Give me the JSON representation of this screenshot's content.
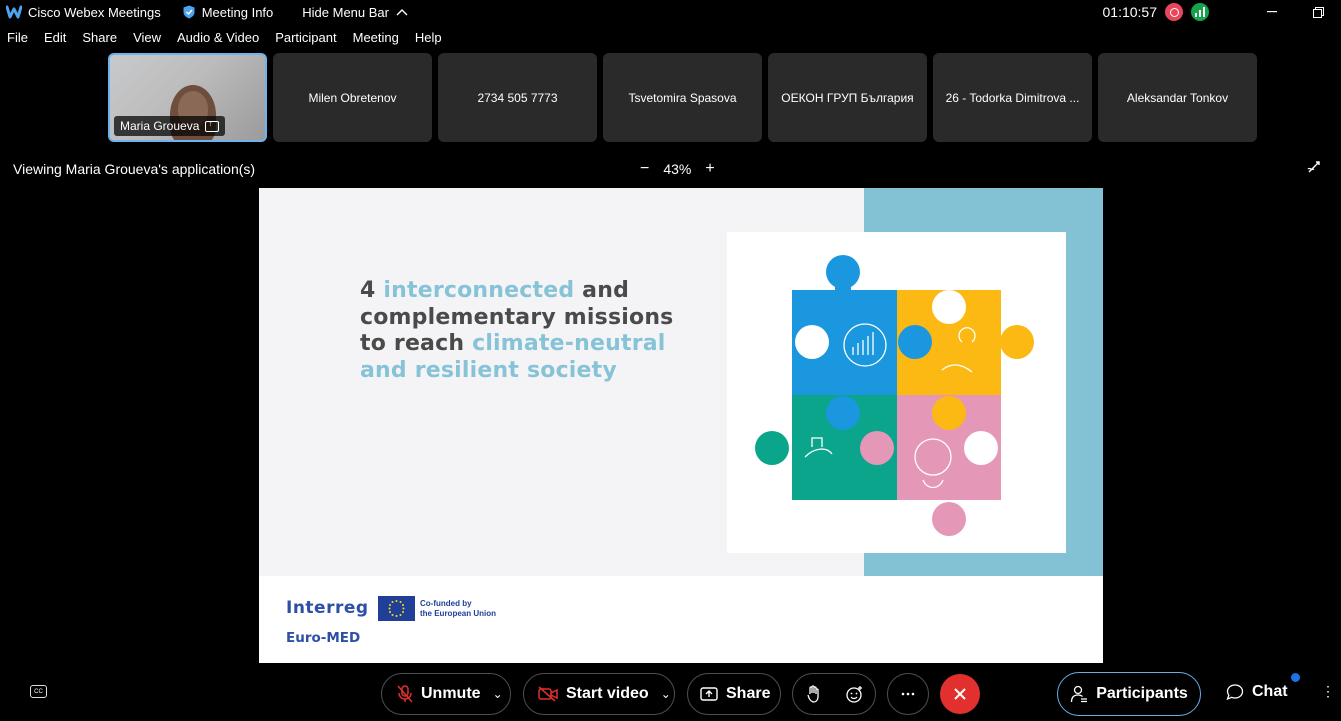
{
  "titlebar": {
    "app_name": "Cisco Webex Meetings",
    "meeting_info": "Meeting Info",
    "hide_menu": "Hide Menu Bar",
    "clock": "01:10:57"
  },
  "menu": [
    "File",
    "Edit",
    "Share",
    "View",
    "Audio & Video",
    "Participant",
    "Meeting",
    "Help"
  ],
  "participants_strip": [
    {
      "name": "Maria Groueva",
      "active": true
    },
    {
      "name": "Milen Obretenov"
    },
    {
      "name": "2734 505 7773"
    },
    {
      "name": "Tsvetomira Spasova"
    },
    {
      "name": "ОЕКОН ГРУП България"
    },
    {
      "name": "26 - Todorka Dimitrova ..."
    },
    {
      "name": "Aleksandar Tonkov"
    }
  ],
  "share_bar": {
    "viewing": "Viewing Maria Groueva's application(s)",
    "zoom_minus": "−",
    "zoom": "43%",
    "zoom_plus": "+"
  },
  "slide": {
    "headline": {
      "part1": "4 ",
      "part2": "interconnected",
      "part3": " and",
      "part4": "complementary missions",
      "part5": "to reach ",
      "part6": "climate-neutral",
      "part7": "and resilient society"
    },
    "logo_interreg": "Interreg",
    "logo_euromed": "Euro-MED",
    "eu_text_1": "Co-funded by",
    "eu_text_2": "the European Union",
    "puzzle_colors": {
      "blue": "#1a97de",
      "yellow": "#fdb913",
      "green": "#0aa58a",
      "pink": "#e597b8"
    }
  },
  "toolbar": {
    "unmute": "Unmute",
    "start_video": "Start video",
    "share": "Share",
    "participants": "Participants",
    "chat": "Chat",
    "accent_red": "#e2302f",
    "accent_blue": "#6aaee8"
  }
}
